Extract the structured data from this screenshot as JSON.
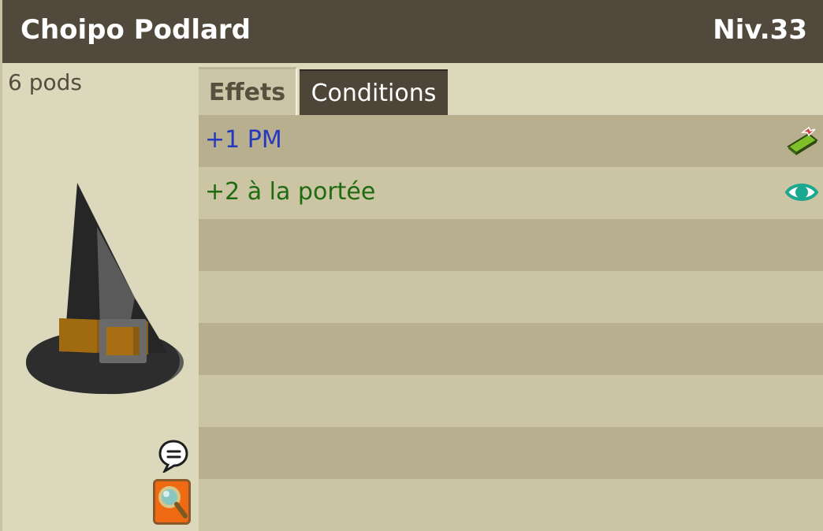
{
  "item": {
    "name": "Choipo Podlard",
    "level": "Niv.33",
    "weight": "6 pods",
    "image_icon": "witch-hat-item-icon"
  },
  "tabs": [
    {
      "label": "Effets",
      "active": true
    },
    {
      "label": "Conditions",
      "active": false
    }
  ],
  "effects": [
    {
      "text": "+1 PM",
      "color": "#2638c0",
      "icon": "movement-points-icon"
    },
    {
      "text": "+2 à la portée",
      "color": "#1f6b12",
      "icon": "eye-range-icon"
    }
  ],
  "actions": {
    "chat_icon": "speech-bubble-icon",
    "inspect_icon": "magnifier-icon"
  },
  "colors": {
    "header_bg": "#51493c",
    "panel_bg": "#dcd8bb",
    "row_dark": "#b8af8f",
    "row_light": "#ccc5a4"
  }
}
